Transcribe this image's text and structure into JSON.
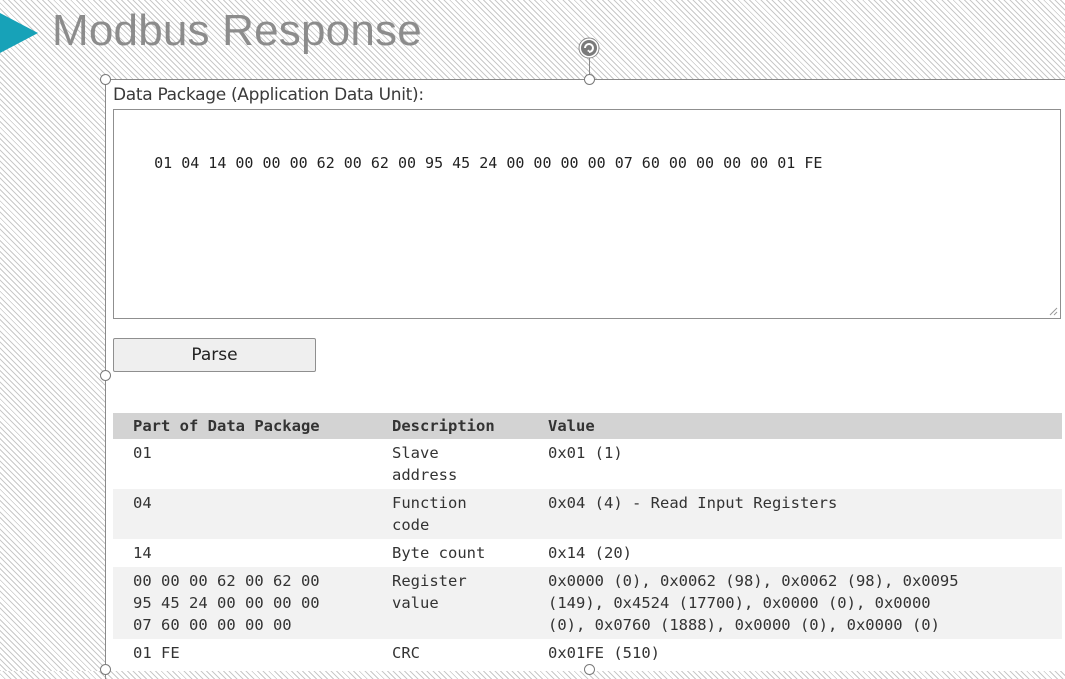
{
  "page_title": "Modbus Response",
  "textarea": {
    "label": "Data Package (Application Data Unit):",
    "value": "01 04 14 00 00 00 62 00 62 00 95 45 24 00 00 00 00 07 60 00 00 00 00 01 FE"
  },
  "parse_button": "Parse",
  "table": {
    "headers": [
      "Part of Data Package",
      "Description",
      "Value"
    ],
    "rows": [
      [
        "01",
        "Slave\naddress",
        "0x01 (1)"
      ],
      [
        "04",
        "Function\ncode",
        "0x04 (4) - Read Input Registers"
      ],
      [
        "14",
        "Byte count",
        "0x14 (20)"
      ],
      [
        "00 00 00 62 00 62 00\n95 45 24 00 00 00 00\n07 60 00 00 00 00",
        "Register\nvalue",
        "0x0000 (0), 0x0062 (98), 0x0062 (98), 0x0095\n(149), 0x4524 (17700), 0x0000 (0), 0x0000\n(0), 0x0760 (1888), 0x0000 (0), 0x0000 (0)"
      ],
      [
        "01 FE",
        "CRC",
        "0x01FE (510)"
      ]
    ]
  },
  "colors": {
    "accent_triangle": "#17a2b8",
    "title_text": "#8c8c8c",
    "table_header_bg": "#d3d3d3",
    "table_alt_row_bg": "#f2f2f2"
  },
  "icons": {
    "rotate_handle": "rotate-icon",
    "resize_grip": "resize-grip-icon",
    "title_marker": "triangle-icon"
  }
}
